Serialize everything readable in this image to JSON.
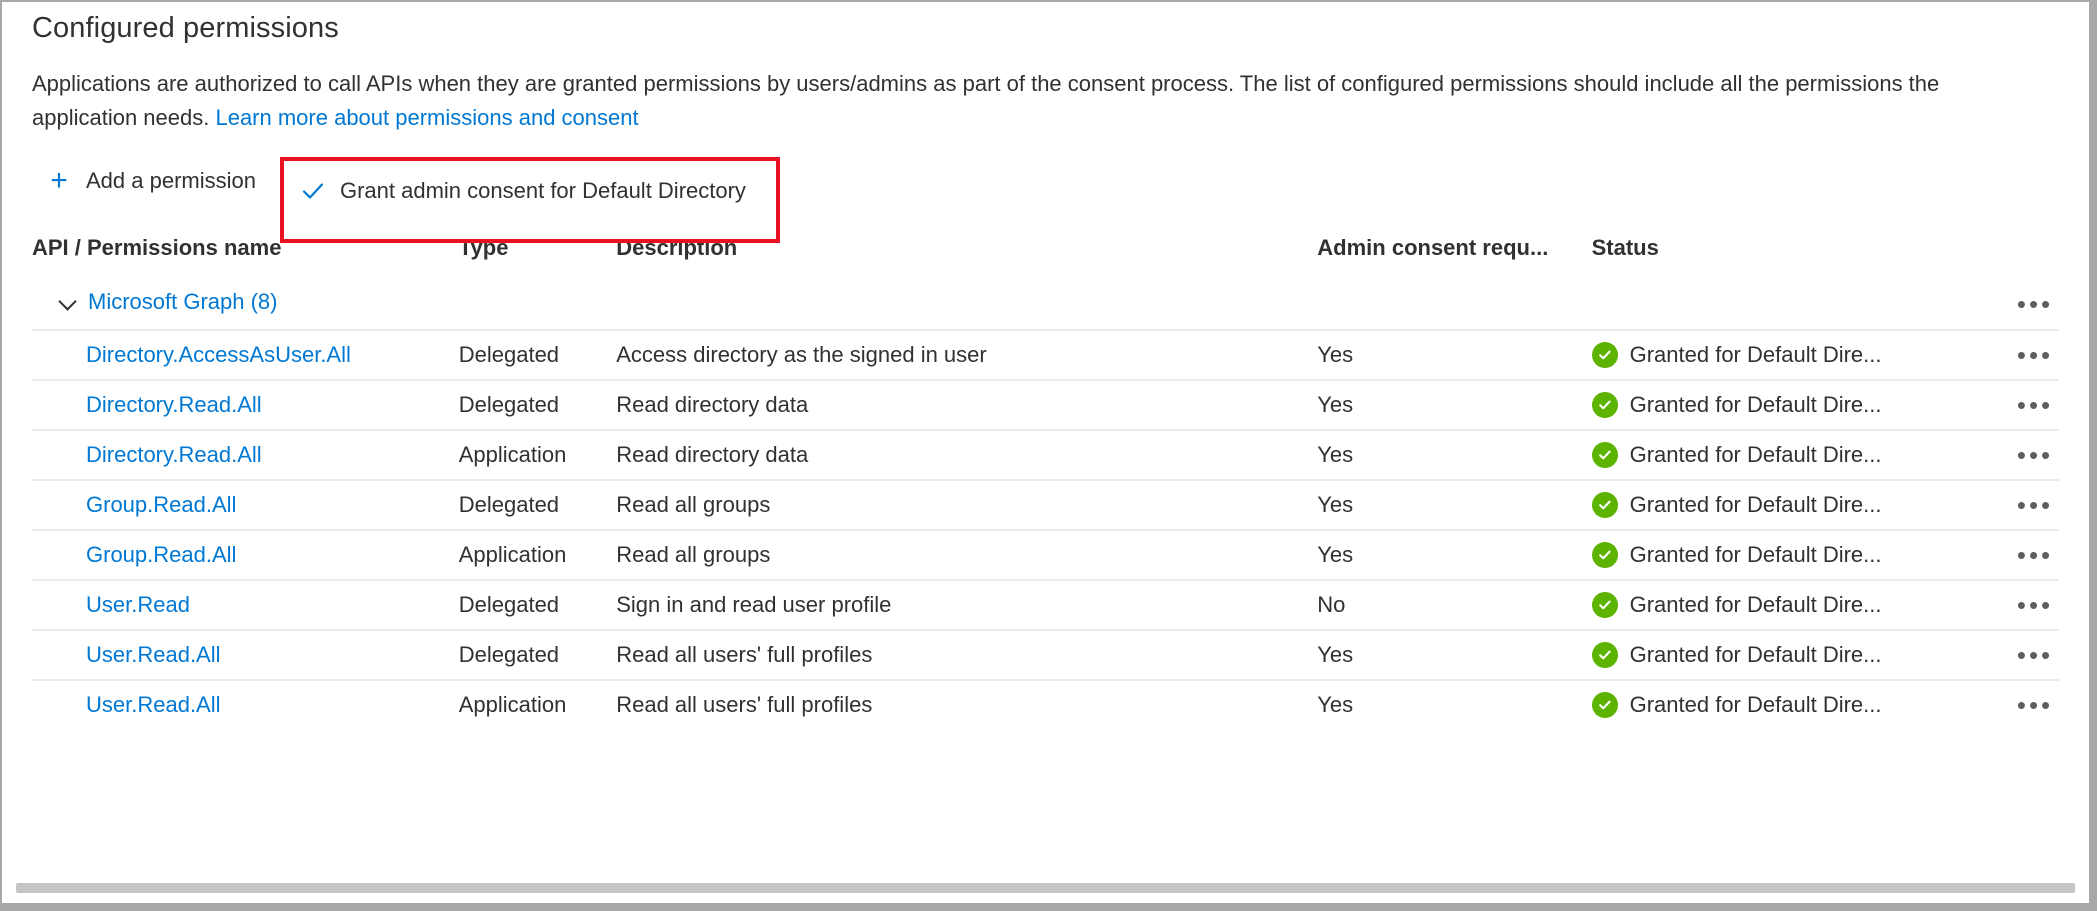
{
  "page_title": "Configured permissions",
  "description": {
    "text": "Applications are authorized to call APIs when they are granted permissions by users/admins as part of the consent process. The list of configured permissions should include all the permissions the application needs. ",
    "link_text": "Learn more about permissions and consent"
  },
  "commandbar": {
    "add_permission_label": "Add a permission",
    "add_permission_icon": "plus-icon",
    "grant_consent_label": "Grant admin consent for Default Directory",
    "grant_consent_icon": "checkmark-icon",
    "highlight_color": "#e81123"
  },
  "table": {
    "headers": {
      "name": "API / Permissions name",
      "type": "Type",
      "description": "Description",
      "admin_consent": "Admin consent requ...",
      "status": "Status"
    },
    "group": {
      "label": "Microsoft Graph (8)",
      "expanded": true,
      "chevron_icon": "chevron-down-icon",
      "menu_icon": "ellipsis-icon"
    },
    "rows": [
      {
        "name": "Directory.AccessAsUser.All",
        "type": "Delegated",
        "description": "Access directory as the signed in user",
        "admin_consent": "Yes",
        "status": "Granted for Default Dire...",
        "status_icon": "green-check-icon",
        "menu_icon": "ellipsis-icon"
      },
      {
        "name": "Directory.Read.All",
        "type": "Delegated",
        "description": "Read directory data",
        "admin_consent": "Yes",
        "status": "Granted for Default Dire...",
        "status_icon": "green-check-icon",
        "menu_icon": "ellipsis-icon"
      },
      {
        "name": "Directory.Read.All",
        "type": "Application",
        "description": "Read directory data",
        "admin_consent": "Yes",
        "status": "Granted for Default Dire...",
        "status_icon": "green-check-icon",
        "menu_icon": "ellipsis-icon"
      },
      {
        "name": "Group.Read.All",
        "type": "Delegated",
        "description": "Read all groups",
        "admin_consent": "Yes",
        "status": "Granted for Default Dire...",
        "status_icon": "green-check-icon",
        "menu_icon": "ellipsis-icon"
      },
      {
        "name": "Group.Read.All",
        "type": "Application",
        "description": "Read all groups",
        "admin_consent": "Yes",
        "status": "Granted for Default Dire...",
        "status_icon": "green-check-icon",
        "menu_icon": "ellipsis-icon"
      },
      {
        "name": "User.Read",
        "type": "Delegated",
        "description": "Sign in and read user profile",
        "admin_consent": "No",
        "status": "Granted for Default Dire...",
        "status_icon": "green-check-icon",
        "menu_icon": "ellipsis-icon"
      },
      {
        "name": "User.Read.All",
        "type": "Delegated",
        "description": "Read all users' full profiles",
        "admin_consent": "Yes",
        "status": "Granted for Default Dire...",
        "status_icon": "green-check-icon",
        "menu_icon": "ellipsis-icon"
      },
      {
        "name": "User.Read.All",
        "type": "Application",
        "description": "Read all users' full profiles",
        "admin_consent": "Yes",
        "status": "Granted for Default Dire...",
        "status_icon": "green-check-icon",
        "menu_icon": "ellipsis-icon"
      }
    ],
    "menu_glyph": "•••"
  },
  "colors": {
    "link": "#0078d4",
    "text": "#323130",
    "success": "#5cb300",
    "highlight": "#e81123"
  }
}
